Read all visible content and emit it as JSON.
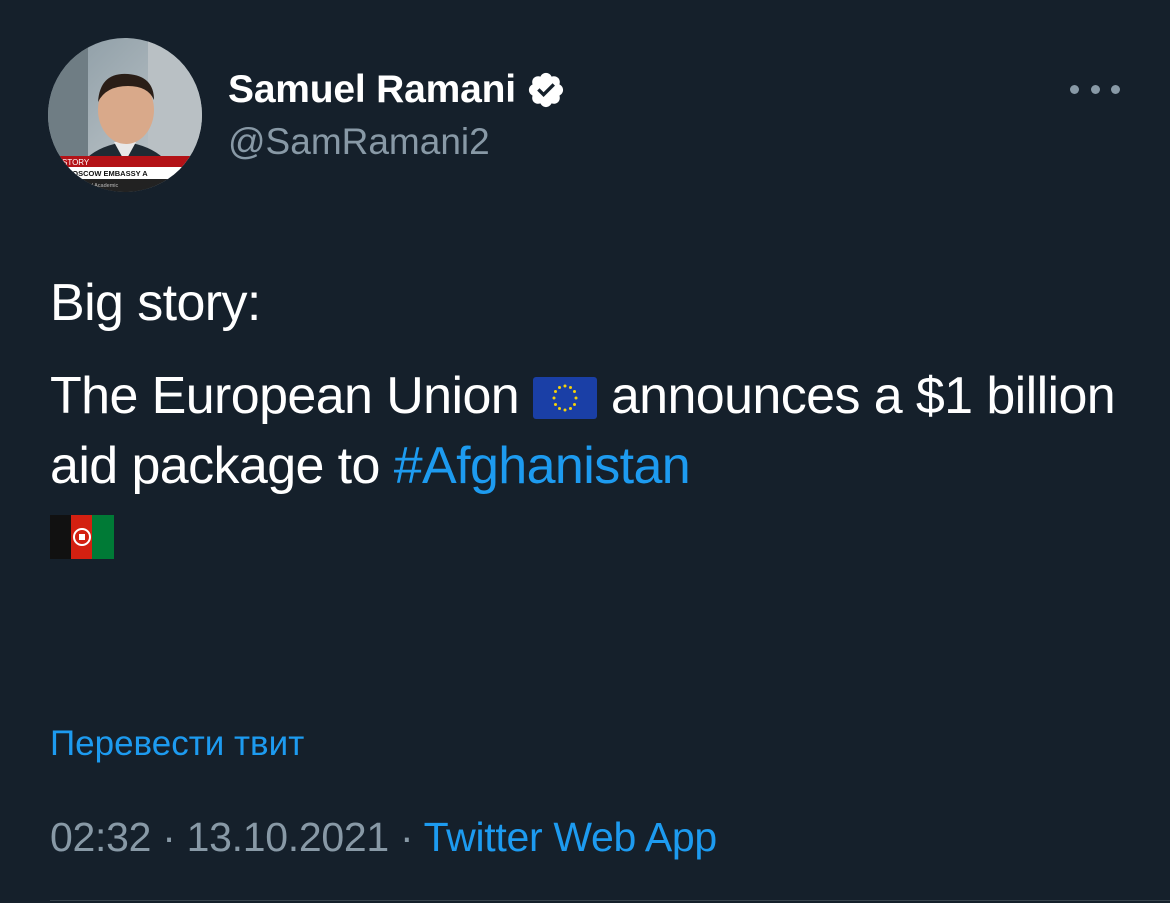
{
  "tweet": {
    "author": {
      "display_name": "Samuel Ramani",
      "handle": "@SamRamani2",
      "verified": true,
      "avatar_icon": "avatar-photo",
      "avatar_caption": {
        "line1": "STORY",
        "line2": "MOSCOW EMBASSY A",
        "line3": "rd Academic"
      }
    },
    "more_icon": "more-horizontal-icon",
    "text": {
      "line1": "Big story:",
      "segment_before_flag": "The European Union",
      "eu_flag_icon": "eu-flag-emoji",
      "segment_after_flag": "announces a $1 billion aid package to",
      "hashtag": "#Afghanistan",
      "afghan_flag_icon": "afghanistan-flag-emoji"
    },
    "translate_label": "Перевести твит",
    "meta": {
      "time": "02:32",
      "separator": " · ",
      "date": "13.10.2021",
      "source": "Twitter Web App"
    }
  },
  "colors": {
    "background": "#15202b",
    "text_primary": "#ffffff",
    "text_secondary": "#8899a6",
    "link": "#1d9bf0",
    "verified_badge": "#ffffff"
  }
}
